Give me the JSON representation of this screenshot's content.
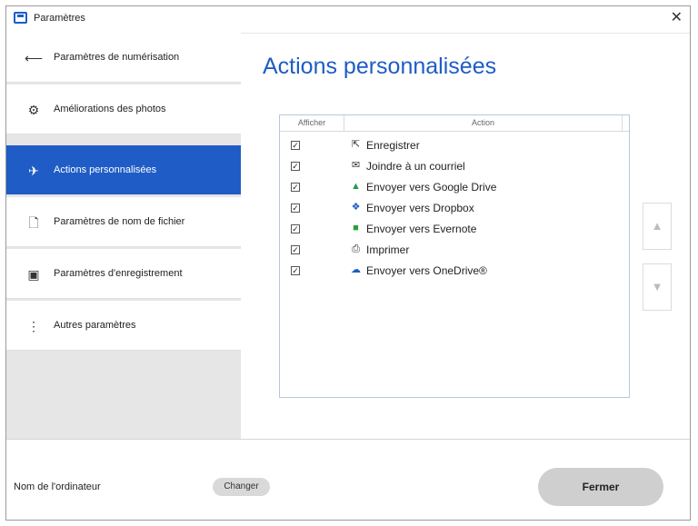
{
  "window": {
    "title": "Paramètres",
    "close_glyph": "✕"
  },
  "sidebar": {
    "items": [
      {
        "label": "Paramètres de numérisation",
        "icon": "scan-icon",
        "glyph": "⟵"
      },
      {
        "label": "Améliorations des photos",
        "icon": "photo-enhance-icon",
        "glyph": "⚙"
      },
      {
        "label": "Actions personnalisées",
        "icon": "send-icon",
        "glyph": "✈"
      },
      {
        "label": "Paramètres de nom de fichier",
        "icon": "file-icon",
        "glyph": "🗋"
      },
      {
        "label": "Paramètres d'enregistrement",
        "icon": "save-icon",
        "glyph": "▣"
      },
      {
        "label": "Autres paramètres",
        "icon": "more-icon",
        "glyph": "⋮"
      }
    ],
    "active_index": 2
  },
  "main": {
    "title": "Actions personnalisées",
    "table": {
      "headers": {
        "show": "Afficher",
        "action": "Action"
      },
      "rows": [
        {
          "checked": true,
          "label": "Enregistrer",
          "icon": "save-icon",
          "glyph": "⇱",
          "color": "#333333"
        },
        {
          "checked": true,
          "label": "Joindre à un courriel",
          "icon": "email-icon",
          "glyph": "✉",
          "color": "#333333"
        },
        {
          "checked": true,
          "label": "Envoyer vers Google Drive",
          "icon": "google-drive-icon",
          "glyph": "▲",
          "color": "#1e9e4a"
        },
        {
          "checked": true,
          "label": "Envoyer vers Dropbox",
          "icon": "dropbox-icon",
          "glyph": "❖",
          "color": "#1f5cc6"
        },
        {
          "checked": true,
          "label": "Envoyer vers Evernote",
          "icon": "evernote-icon",
          "glyph": "■",
          "color": "#2e9e3a"
        },
        {
          "checked": true,
          "label": "Imprimer",
          "icon": "print-icon",
          "glyph": "⎙",
          "color": "#333333"
        },
        {
          "checked": true,
          "label": "Envoyer vers OneDrive®",
          "icon": "onedrive-icon",
          "glyph": "☁",
          "color": "#1f5cc6"
        }
      ]
    },
    "move_up_glyph": "▲",
    "move_down_glyph": "▼"
  },
  "footer": {
    "computer_label": "Nom de l'ordinateur",
    "change_label": "Changer",
    "close_label": "Fermer"
  },
  "colors": {
    "accent": "#1f5cc6"
  }
}
